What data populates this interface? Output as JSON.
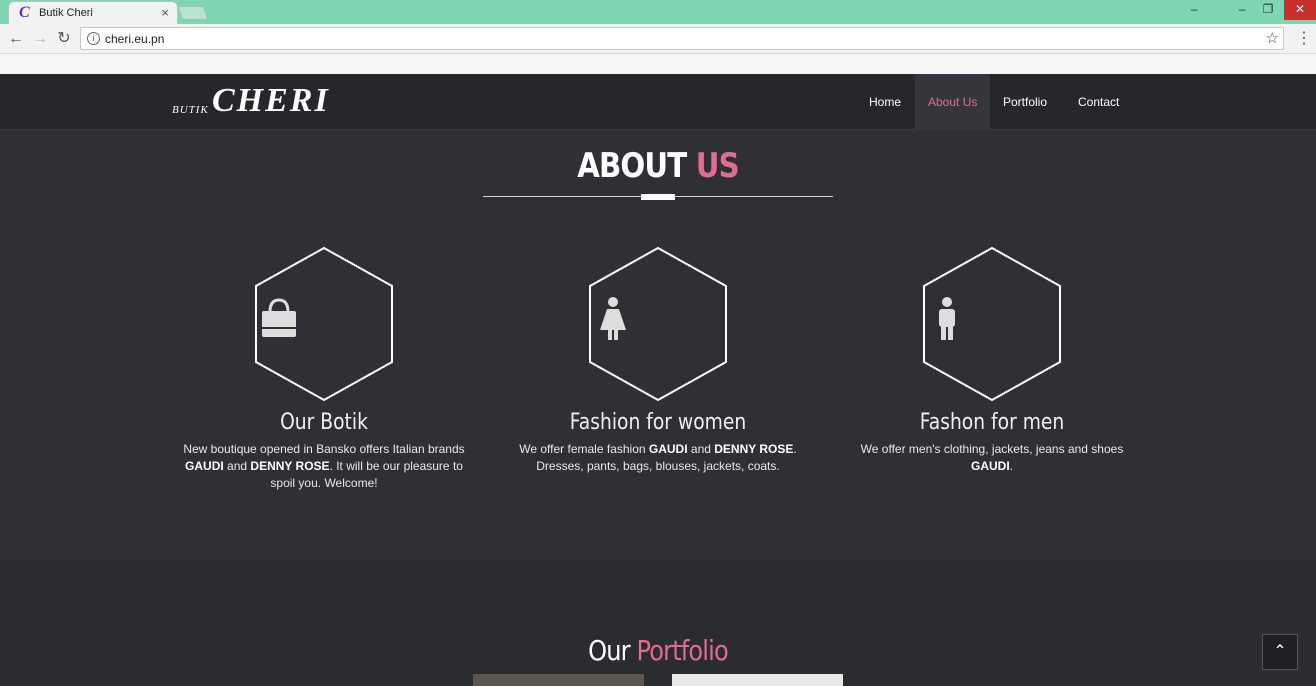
{
  "browser": {
    "tab_title": "Butik Cheri",
    "tab_close": "×",
    "favicon": "C",
    "url": "cheri.eu.pn",
    "back": "←",
    "forward": "→",
    "reload": "↻",
    "info": "i",
    "star": "☆",
    "menu": "⋮",
    "win_min": "–",
    "win_min2": "–",
    "win_max": "❐",
    "win_close": "✕"
  },
  "site": {
    "logo_small": "BUTIK",
    "logo_big": "CHERI",
    "nav": [
      {
        "label": "Home",
        "active": false
      },
      {
        "label": "About Us",
        "active": true
      },
      {
        "label": "Portfolio",
        "active": false
      },
      {
        "label": "Contact",
        "active": false
      }
    ],
    "about": {
      "title_part1": "ABOUT",
      "title_part2": "US"
    },
    "features": [
      {
        "icon": "shopping-bag-icon",
        "title": "Our Botik",
        "text_parts": [
          "New boutique opened in Bansko offers Italian brands ",
          "GAUDI",
          " and ",
          "DENNY ROSE",
          ". It will be our pleasure to spoil you. Welcome!"
        ]
      },
      {
        "icon": "female-icon",
        "title": "Fashion for women",
        "text_parts": [
          "We offer female fashion ",
          "GAUDI",
          " and ",
          "DENNY ROSE",
          ". Dresses, pants, bags, blouses, jackets, coats."
        ]
      },
      {
        "icon": "male-icon",
        "title": "Fashon for men",
        "text_parts": [
          "We offer men's clothing, jackets, jeans and shoes ",
          "GAUDI",
          ".",
          "",
          ""
        ]
      }
    ],
    "portfolio": {
      "title_part1": "Our",
      "title_part2": "Portfolio"
    },
    "scroll_top": "⌃"
  },
  "colors": {
    "accent": "#e06c92",
    "background": "#2f3035",
    "navbar": "#26272b",
    "chrome": "#7fd6b3"
  }
}
